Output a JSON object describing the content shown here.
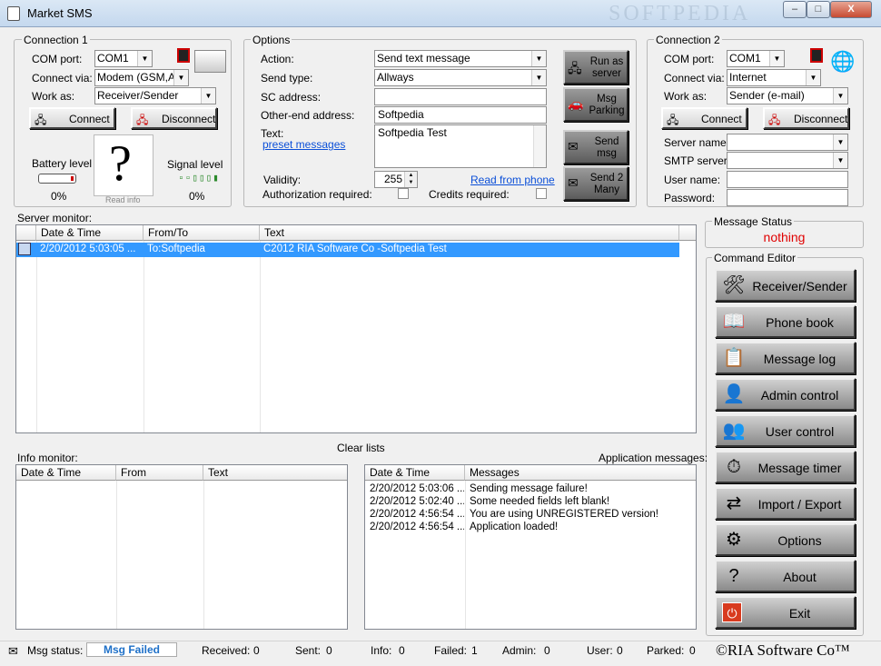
{
  "window": {
    "title": "Market SMS",
    "watermark": "SOFTPEDIA",
    "minimize": "–",
    "maximize": "□",
    "close": "X"
  },
  "connection1": {
    "legend": "Connection 1",
    "com_port_label": "COM port:",
    "com_port": "COM1",
    "connect_via_label": "Connect via:",
    "connect_via": "Modem (GSM,AT)",
    "work_as_label": "Work as:",
    "work_as": "Receiver/Sender",
    "connect": "Connect",
    "disconnect": "Disconnect",
    "battery_label": "Battery level",
    "battery_value": "0%",
    "signal_label": "Signal level",
    "signal_value": "0%",
    "read_info": "Read info",
    "question": "?"
  },
  "options": {
    "legend": "Options",
    "action_label": "Action:",
    "action": "Send text message",
    "send_type_label": "Send type:",
    "send_type": "Allways",
    "sc_address_label": "SC address:",
    "sc_address": "",
    "other_end_label": "Other-end address:",
    "other_end": "Softpedia",
    "text_label": "Text:",
    "preset": "preset messages",
    "text": "Softpedia Test",
    "validity_label": "Validity:",
    "validity": "255",
    "read_from_phone": "Read from phone",
    "auth_label": "Authorization required:",
    "credits_label": "Credits required:",
    "run_as_server": "Run as server",
    "msg_parking": "Msg Parking",
    "send_msg": "Send msg",
    "send_many": "Send 2 Many"
  },
  "connection2": {
    "legend": "Connection 2",
    "com_port_label": "COM port:",
    "com_port": "COM1",
    "connect_via_label": "Connect via:",
    "connect_via": "Internet",
    "work_as_label": "Work as:",
    "work_as": "Sender (e-mail)",
    "connect": "Connect",
    "disconnect": "Disconnect",
    "server_name_label": "Server name:",
    "smtp_label": "SMTP server:",
    "user_name_label": "User name:",
    "password_label": "Password:"
  },
  "server_monitor": {
    "title": "Server monitor:",
    "columns": [
      "Date & Time",
      "From/To",
      "Text"
    ],
    "rows": [
      {
        "date": "2/20/2012 5:03:05 ...",
        "from": "To:Softpedia",
        "text": "C2012 RIA Software Co -Softpedia Test"
      }
    ]
  },
  "message_status": {
    "title": "Message Status",
    "value": "nothing",
    "color": "#e00000"
  },
  "clear_lists": "Clear lists",
  "info_monitor": {
    "title": "Info monitor:",
    "columns": [
      "Date & Time",
      "From",
      "Text"
    ]
  },
  "app_messages": {
    "title": "Application messages:",
    "columns": [
      "Date & Time",
      "Messages"
    ],
    "rows": [
      {
        "date": "2/20/2012 5:03:06 ...",
        "msg": "Sending message failure!"
      },
      {
        "date": "2/20/2012 5:02:40 ...",
        "msg": "Some needed fields left blank!"
      },
      {
        "date": "2/20/2012 4:56:54 ...",
        "msg": "You are using UNREGISTERED version!"
      },
      {
        "date": "2/20/2012 4:56:54 ...",
        "msg": "Application loaded!"
      }
    ]
  },
  "command_editor": {
    "title": "Command Editor",
    "items": [
      {
        "label": "Receiver/Sender",
        "icon": "tools-icon"
      },
      {
        "label": "Phone book",
        "icon": "book-icon"
      },
      {
        "label": "Message log",
        "icon": "log-icon"
      },
      {
        "label": "Admin control",
        "icon": "admin-icon"
      },
      {
        "label": "User control",
        "icon": "users-icon"
      },
      {
        "label": "Message timer",
        "icon": "timer-icon"
      },
      {
        "label": "Import / Export",
        "icon": "import-export-icon"
      },
      {
        "label": "Options",
        "icon": "options-icon"
      },
      {
        "label": "About",
        "icon": "help-icon"
      },
      {
        "label": "Exit",
        "icon": "exit-icon"
      }
    ]
  },
  "statusbar": {
    "msg_status_label": "Msg status:",
    "msg_status": "Msg Failed",
    "received_label": "Received:",
    "received": "0",
    "sent_label": "Sent:",
    "sent": "0",
    "info_label": "Info:",
    "info": "0",
    "failed_label": "Failed:",
    "failed": "1",
    "admin_label": "Admin:",
    "admin": "0",
    "user_label": "User:",
    "user": "0",
    "parked_label": "Parked:",
    "parked": "0",
    "copyright": "©RIA Software Co™"
  }
}
